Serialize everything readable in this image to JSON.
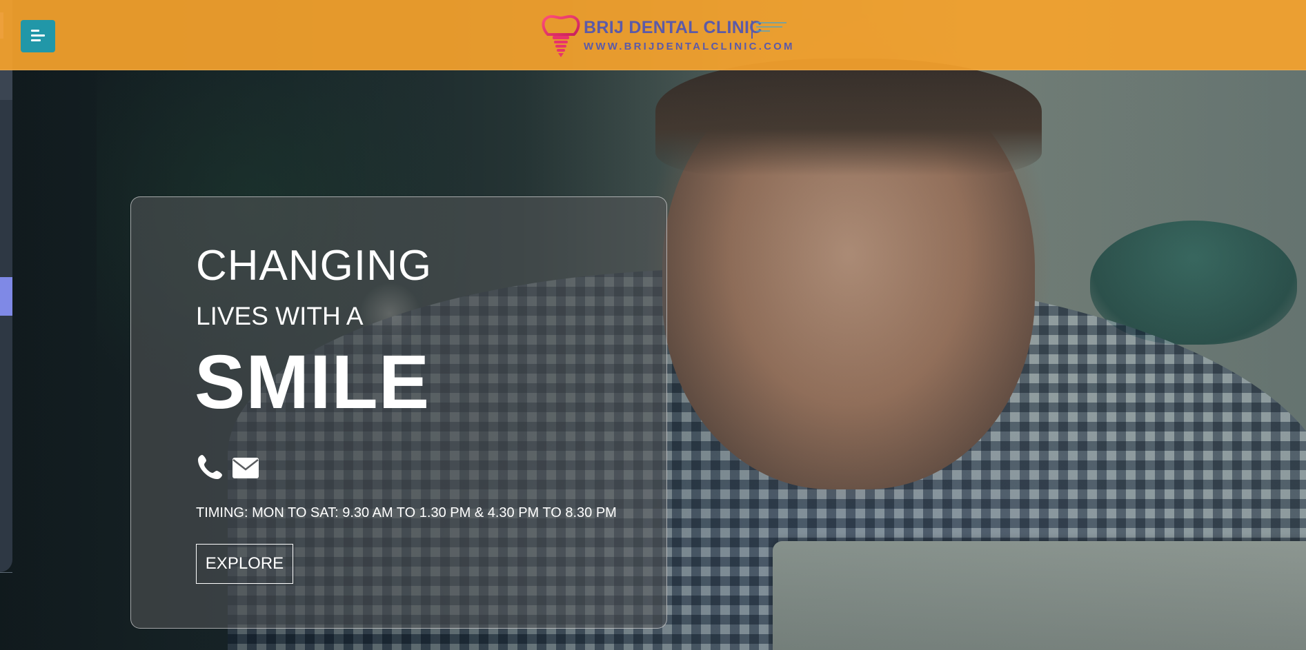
{
  "header": {
    "menu_icon": "menu-icon",
    "logo": {
      "name": "BRIJ DENTAL CLINIC",
      "url": "WWW.BRIJDENTALCLINIC.COM",
      "icon": "tooth-implant-icon"
    }
  },
  "hero": {
    "line1": "CHANGING",
    "line2": "LIVES WITH A",
    "line3": "SMILE",
    "phone_icon": "phone-icon",
    "mail_icon": "mail-icon",
    "timing": "TIMING: MON TO SAT: 9.30 AM TO 1.30 PM & 4.30 PM TO 8.30 PM",
    "cta_label": "EXPLORE"
  },
  "colors": {
    "header_bg": "#f6a32d",
    "menu_button": "#2197a8",
    "logo_text": "#5b5aa8",
    "logo_icon": "#e8336b",
    "side_accent": "#7f89e6"
  }
}
